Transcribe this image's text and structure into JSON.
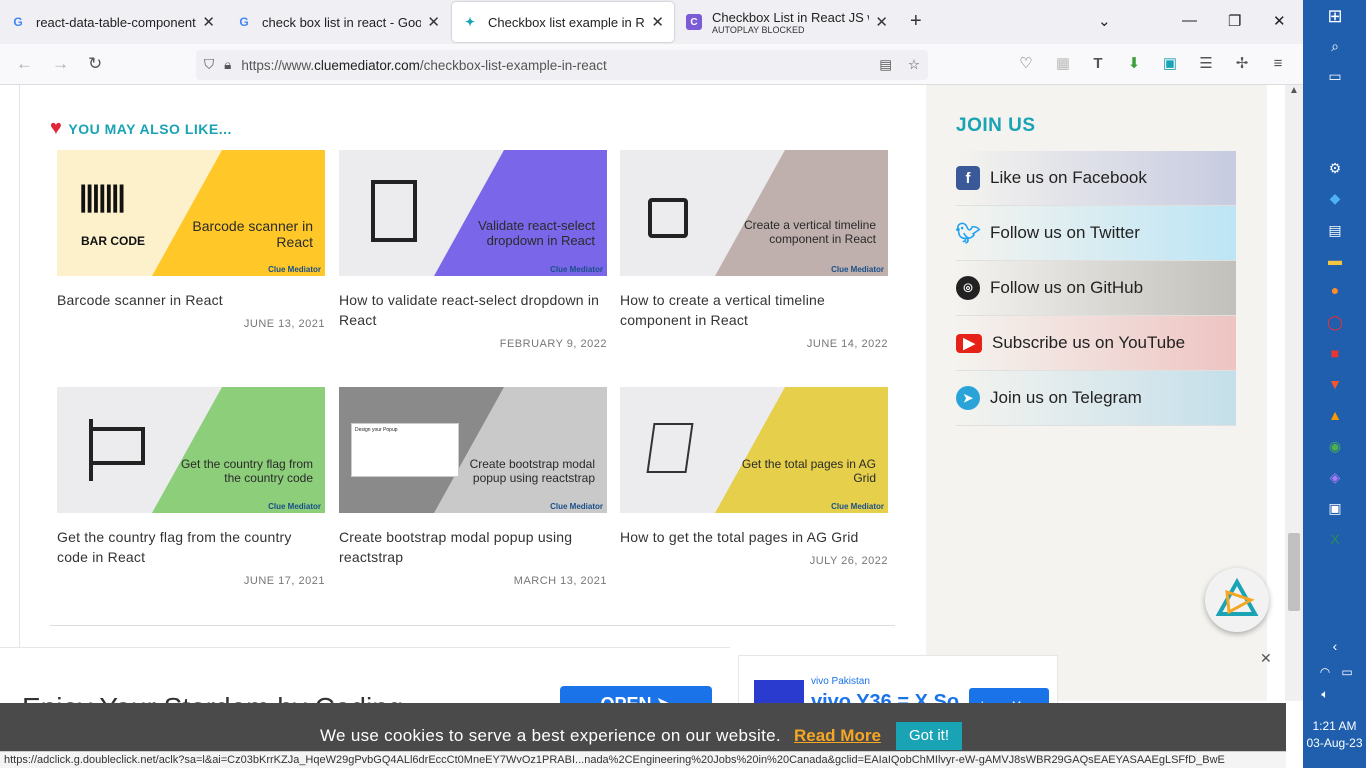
{
  "browser": {
    "tabs": [
      {
        "title": "react-data-table-component ce",
        "favicon": "google-icon"
      },
      {
        "title": "check box list in react - Google",
        "favicon": "google-icon"
      },
      {
        "title": "Checkbox list example in React",
        "favicon": "cluemediator-icon",
        "active": true
      },
      {
        "title": "Checkbox List in React JS with",
        "subtitle": "AUTOPLAY BLOCKED",
        "favicon": "c-icon"
      }
    ],
    "url_prefix": "https://www.",
    "url_host": "cluemediator.com",
    "url_path": "/checkbox-list-example-in-react"
  },
  "related": {
    "heading": "YOU MAY ALSO LIKE...",
    "cards": [
      {
        "thumb_text": "Barcode scanner in React",
        "title": "Barcode scanner in React",
        "date": "JUNE 13, 2021",
        "color": "#ffc828",
        "icon_label": "BAR CODE"
      },
      {
        "thumb_text": "Validate react-select dropdown in React",
        "title": "How to validate react-select dropdown in React",
        "date": "FEBRUARY 9, 2022",
        "color": "#7a66e8"
      },
      {
        "thumb_text": "Create a vertical timeline component in React",
        "title": "How to create a vertical timeline component in React",
        "date": "JUNE 14, 2022",
        "color": "#bfb0ad"
      },
      {
        "thumb_text": "Get the country flag from the country code",
        "title": "Get the country flag from the country code in React",
        "date": "JUNE 17, 2021",
        "color": "#8cce7a"
      },
      {
        "thumb_text": "Create bootstrap modal popup using reactstrap",
        "title": "Create bootstrap modal popup using reactstrap",
        "date": "MARCH 13, 2021",
        "color": "#c9c9c9",
        "popup_title": "Design your Popup"
      },
      {
        "thumb_text": "Get the total pages in AG Grid",
        "title": "How to get the total pages in AG Grid",
        "date": "JULY 26, 2022",
        "color": "#e6cf4a"
      }
    ],
    "thumb_brand": "Clue Mediator"
  },
  "sidebar": {
    "heading": "JOIN US",
    "links": [
      {
        "label": "Like us on Facebook",
        "icon": "facebook-icon",
        "color": "#3b5998",
        "bg": "#c7cbe0"
      },
      {
        "label": "Follow us on Twitter",
        "icon": "twitter-icon",
        "color": "#1da1f2",
        "bg": "#bde5f5"
      },
      {
        "label": "Follow us on GitHub",
        "icon": "github-icon",
        "color": "#222222",
        "bg": "#c2c0bb"
      },
      {
        "label": "Subscribe us on YouTube",
        "icon": "youtube-icon",
        "color": "#e62117",
        "bg": "#eec4c2"
      },
      {
        "label": "Join us on Telegram",
        "icon": "telegram-icon",
        "color": "#2aa3d9",
        "bg": "#c4dfea"
      }
    ]
  },
  "ads": {
    "left_text": "Enjoy Your Stardom by Coding",
    "left_button": "OPEN",
    "right_brand": "vivo Pakistan",
    "right_text": "vivo Y36 = X So",
    "right_button": "Learn More"
  },
  "cookie": {
    "message": "We use cookies to serve a best experience on our website.",
    "read_more": "Read More",
    "button": "Got it!"
  },
  "status_url": "https://adclick.g.doubleclick.net/aclk?sa=l&ai=Cz03bKrrKZJa_HqeW29gPvbGQ4ALl6drEccCt0MneEY7WvOz1PRABI...nada%2CEngineering%20Jobs%20in%20Canada&gclid=EAIaIQobChMIlvyr-eW-gAMVJ8sWBR29GAQsEAEYASAAEgLSFfD_BwE",
  "taskbar": {
    "time": "1:21 AM",
    "date": "03-Aug-23"
  }
}
